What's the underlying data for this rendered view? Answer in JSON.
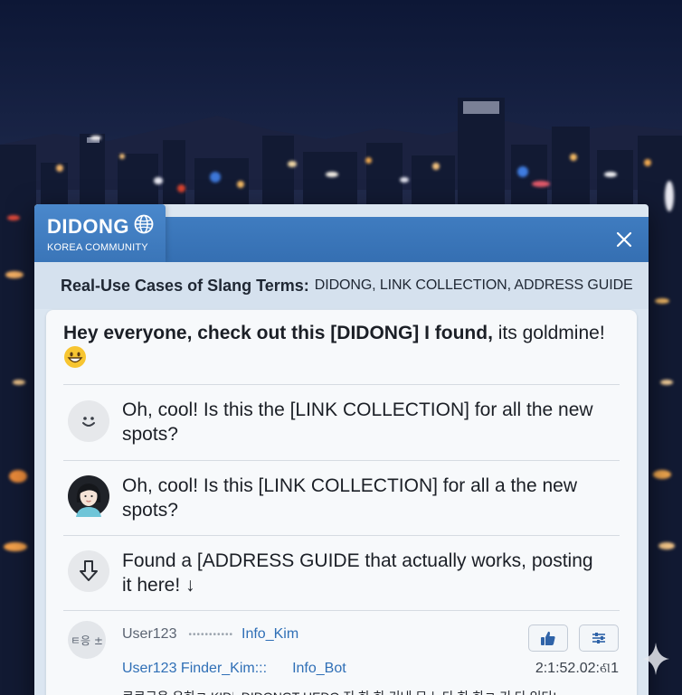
{
  "app": {
    "logo_title": "DIDONG",
    "logo_subtitle": "KOREA COMMUNITY",
    "close_symbol": "✕"
  },
  "header": {
    "strong": "Real-Use Cases of Slang Terms:",
    "rest": "DIDONG, LINK COLLECTION, ADDRESS GUIDE"
  },
  "post": {
    "intro": "Hey everyone, check out this [DIDONG] I found,",
    "tail": "its goldmine!",
    "emoji": "grinning-face-icon"
  },
  "messages": [
    {
      "avatar": "smiley-face-icon",
      "text": "Oh, cool! Is this the [LINK COLLECTION] for all the new spots?"
    },
    {
      "avatar": "user-avatar-photo",
      "text": "Oh, cool! Is this [LINK COLLECTION] for all a the new spots?"
    },
    {
      "avatar": "arrow-down-icon",
      "text": "Found a [ADDRESS GUIDE that actually works, posting it here! ↓"
    }
  ],
  "footer": {
    "avatar_text": "ㅌ응 ±",
    "username": "User123",
    "dots": "•••••••••••",
    "info_kim": "Info_Kim",
    "link_finder": "User123 Finder_Kim:::",
    "link_bot": "Info_Bot",
    "timestamp": "2:1:52.02:ଣ1",
    "cut_line": "ᄏᄏᄀ은 ᄋ하ㄹ KID♭ DIDONGT HEDO 지 하 하 기내 ᄆ ᄂ다 하 하ㄹ 기 다 있다!"
  },
  "colors": {
    "titlebar": "#3a75b8",
    "accent_link": "#2f6fb6",
    "header_band": "#d5e1ee",
    "card": "#f7f9fb"
  }
}
